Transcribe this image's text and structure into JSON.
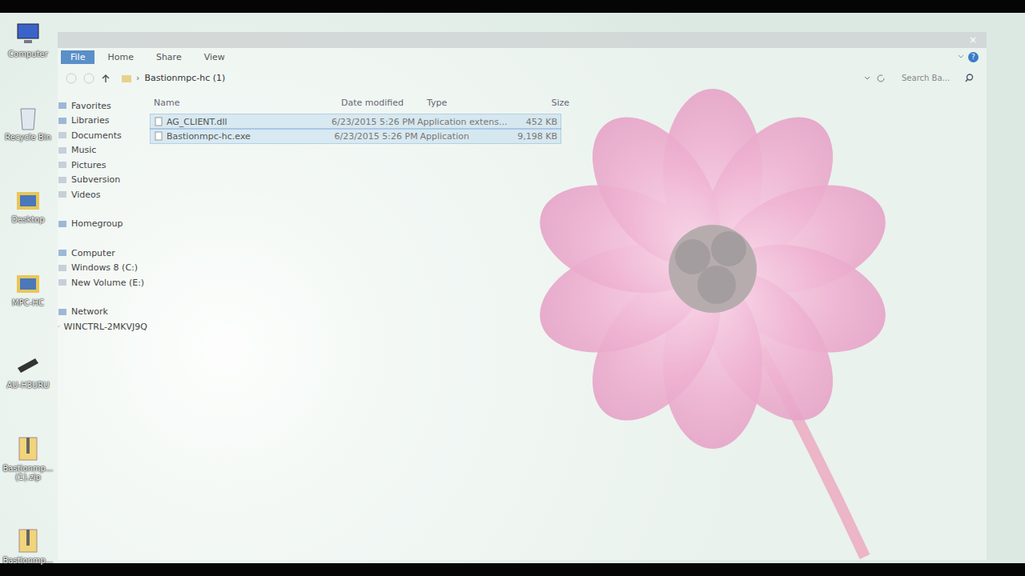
{
  "desktop_icons": [
    {
      "label": "Computer",
      "kind": "computer"
    },
    {
      "label": "Recycle Bin",
      "kind": "recycle"
    },
    {
      "label": "Desktop",
      "kind": "folder"
    },
    {
      "label": "MPC-HC",
      "kind": "folder"
    },
    {
      "label": "AU-H3URU",
      "kind": "app"
    },
    {
      "label": "Bastionmp... (1).zip",
      "kind": "zip"
    },
    {
      "label": "Bastionmp...",
      "kind": "zip"
    }
  ],
  "ribbon": {
    "tabs": [
      {
        "label": "File",
        "selected": true
      },
      {
        "label": "Home",
        "selected": false
      },
      {
        "label": "Share",
        "selected": false
      },
      {
        "label": "View",
        "selected": false
      }
    ],
    "help": "?",
    "close": "×"
  },
  "address": {
    "path": "Bastionmpc-hc (1)",
    "search_placeholder": "Search Ba..."
  },
  "sidebar": {
    "items": [
      {
        "label": "Favorites",
        "kind": "header"
      },
      {
        "label": "Libraries",
        "kind": "header"
      },
      {
        "label": "Documents",
        "kind": "item"
      },
      {
        "label": "Music",
        "kind": "item"
      },
      {
        "label": "Pictures",
        "kind": "item"
      },
      {
        "label": "Subversion",
        "kind": "item"
      },
      {
        "label": "Videos",
        "kind": "item"
      },
      {
        "label": "Homegroup",
        "kind": "header"
      },
      {
        "label": "Computer",
        "kind": "header"
      },
      {
        "label": "Windows 8 (C:)",
        "kind": "item"
      },
      {
        "label": "New Volume (E:)",
        "kind": "item"
      },
      {
        "label": "Network",
        "kind": "header"
      },
      {
        "label": "WINCTRL-2MKVJ9Q",
        "kind": "item"
      }
    ]
  },
  "table": {
    "columns": [
      "Name",
      "Date modified",
      "Type",
      "Size"
    ],
    "rows": [
      {
        "name": "AG_CLIENT.dll",
        "date": "6/23/2015 5:26 PM",
        "type": "Application extens...",
        "size": "452 KB",
        "selected": true
      },
      {
        "name": "Bastionmpc-hc.exe",
        "date": "6/23/2015 5:26 PM",
        "type": "Application",
        "size": "9,198 KB",
        "selected": true
      }
    ]
  }
}
